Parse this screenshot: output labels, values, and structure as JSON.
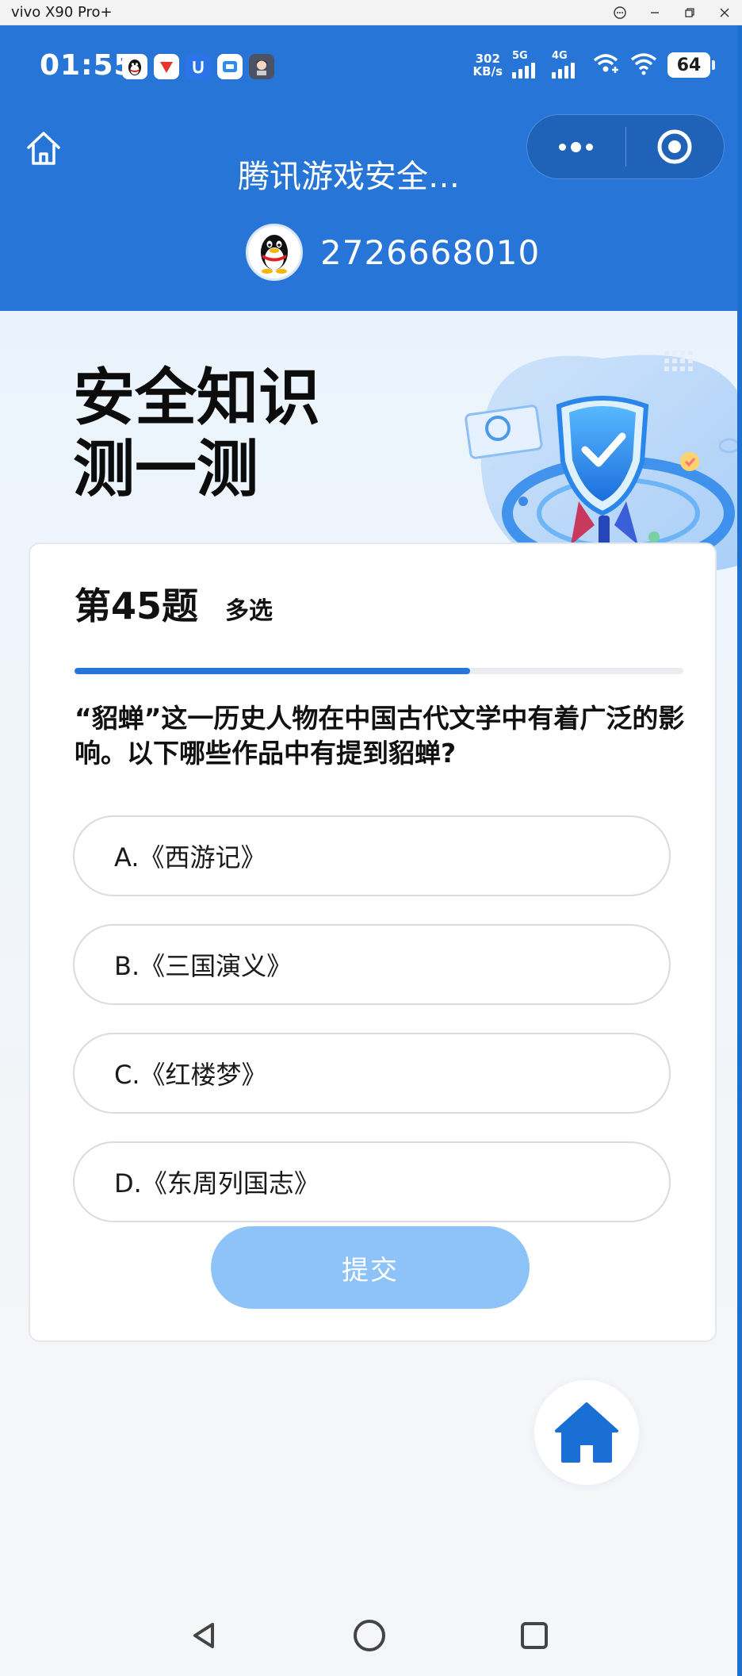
{
  "window": {
    "title": "vivo X90 Pro+",
    "controls": [
      "feedback-icon",
      "minimize-icon",
      "restore-icon",
      "close-icon"
    ]
  },
  "status_bar": {
    "time": "01:55",
    "net_speed_value": "302",
    "net_speed_unit": "KB/s",
    "signal_1_label": "5G",
    "signal_2_label": "4G",
    "battery": "64",
    "app_icons": [
      "qq-icon",
      "tencent-video-icon",
      "notification-app-icon",
      "app-store-icon",
      "avatar-app-icon"
    ]
  },
  "nav": {
    "title": "腾讯游戏安全…",
    "home_icon": "home-outline-icon",
    "menu_icon": "more-dots-icon",
    "close_icon": "target-close-icon"
  },
  "account": {
    "id": "2726668010",
    "avatar_icon": "qq-penguin-icon"
  },
  "hero": {
    "title_line1": "安全知识",
    "title_line2": "测一测"
  },
  "quiz": {
    "number_label": "第45题",
    "type_label": "多选",
    "progress": 0.65,
    "question": "“貂蝉”这一历史人物在中国古代文学中有着广泛的影响。以下哪些作品中有提到貂蝉?",
    "options": [
      {
        "label": "A.《西游记》"
      },
      {
        "label": "B.《三国演义》"
      },
      {
        "label": "C.《红楼梦》"
      },
      {
        "label": "D.《东周列国志》"
      }
    ],
    "submit_label": "提交"
  },
  "colors": {
    "header_blue": "#2775d6",
    "progress_blue": "#2775d6",
    "submit_disabled": "#8ec3f8",
    "home_button_blue": "#1a6fd4"
  }
}
